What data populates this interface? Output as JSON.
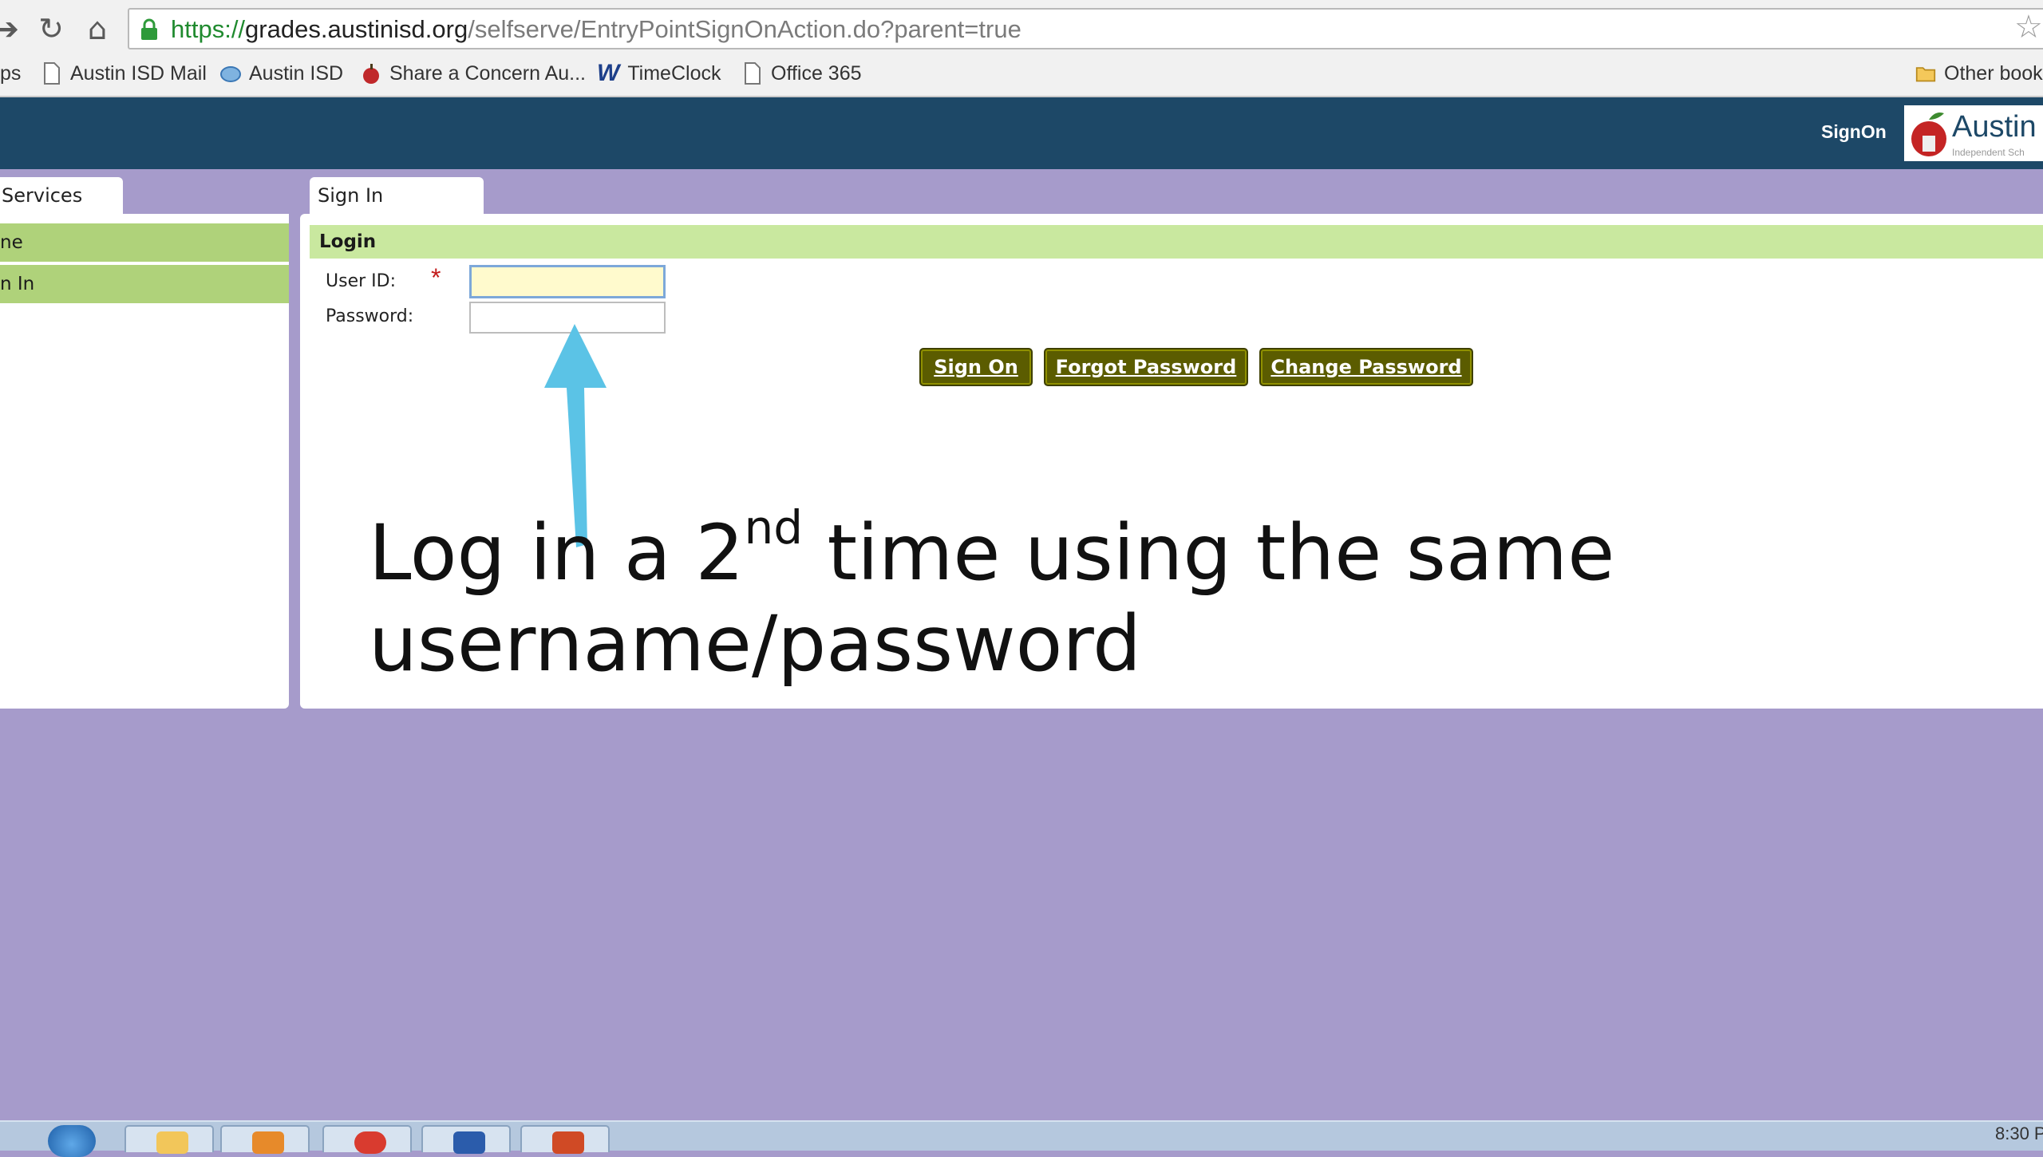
{
  "browser": {
    "url_scheme": "https://",
    "url_host": "grades.austinisd.org",
    "url_path": "/selfserve/EntryPointSignOnAction.do?parent=true",
    "bookmarks": [
      {
        "label": "ps",
        "icon": "apps-icon"
      },
      {
        "label": "Austin ISD Mail",
        "icon": "page-icon"
      },
      {
        "label": "Austin ISD",
        "icon": "austin-isd-icon"
      },
      {
        "label": "Share a Concern Au...",
        "icon": "apple-icon"
      },
      {
        "label": "TimeClock",
        "icon": "w-logo-icon"
      },
      {
        "label": "Office 365",
        "icon": "page-icon"
      }
    ],
    "other_bookmarks": "Other book"
  },
  "header": {
    "signon_label": "SignOn",
    "logo_word": "Austin",
    "logo_sub": "Independent Sch"
  },
  "sidebar": {
    "tab_label": "Services",
    "items": [
      {
        "label": "ne"
      },
      {
        "label": "n In"
      }
    ]
  },
  "main": {
    "tab_label": "Sign In",
    "section_title": "Login",
    "userid_label": "User ID:",
    "required_mark": "*",
    "password_label": "Password:",
    "userid_value": "",
    "password_value": "",
    "buttons": {
      "sign_on": "Sign On",
      "forgot_password": "Forgot Password",
      "change_password": "Change Password"
    }
  },
  "annotation": {
    "line1_pre": "Log in a 2",
    "line1_sup": "nd",
    "line1_post": " time using the same",
    "line2": "username/password",
    "arrow_color": "#5bc3e6"
  },
  "taskbar": {
    "clock": "8:30 P"
  },
  "colors": {
    "header_bg": "#1d4867",
    "page_bg": "#a69bcb",
    "nav_green": "#afd27a",
    "section_green": "#c9e89f",
    "button_olive": "#5b5c00"
  }
}
